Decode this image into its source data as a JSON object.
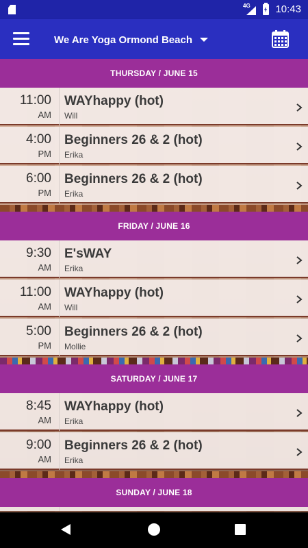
{
  "status_bar": {
    "network": "4G",
    "time": "10:43"
  },
  "app_bar": {
    "location": "We Are Yoga Ormond Beach",
    "menu_icon": "hamburger-menu-icon",
    "calendar_icon": "calendar-icon"
  },
  "colors": {
    "status_bar": "#1f24a8",
    "app_bar": "#2a2fc0",
    "day_header": "#9b2e99"
  },
  "schedule": {
    "days": [
      {
        "label": "THURSDAY / JUNE 15",
        "classes": [
          {
            "time": "11:00",
            "ampm": "AM",
            "name": "WAYhappy (hot)",
            "instructor": "Will"
          },
          {
            "time": "4:00",
            "ampm": "PM",
            "name": "Beginners 26 & 2 (hot)",
            "instructor": "Erika"
          },
          {
            "time": "6:00",
            "ampm": "PM",
            "name": "Beginners 26 & 2 (hot)",
            "instructor": "Erika"
          }
        ]
      },
      {
        "label": "FRIDAY / JUNE 16",
        "classes": [
          {
            "time": "9:30",
            "ampm": "AM",
            "name": "E'sWAY",
            "instructor": "Erika"
          },
          {
            "time": "11:00",
            "ampm": "AM",
            "name": "WAYhappy (hot)",
            "instructor": "Will"
          },
          {
            "time": "5:00",
            "ampm": "PM",
            "name": "Beginners 26 & 2 (hot)",
            "instructor": "Mollie"
          }
        ]
      },
      {
        "label": "SATURDAY / JUNE 17",
        "classes": [
          {
            "time": "8:45",
            "ampm": "AM",
            "name": "WAYhappy (hot)",
            "instructor": "Erika"
          },
          {
            "time": "9:00",
            "ampm": "AM",
            "name": "Beginners 26 & 2 (hot)",
            "instructor": "Erika"
          }
        ]
      },
      {
        "label": "SUNDAY / JUNE 18",
        "classes": []
      }
    ]
  }
}
